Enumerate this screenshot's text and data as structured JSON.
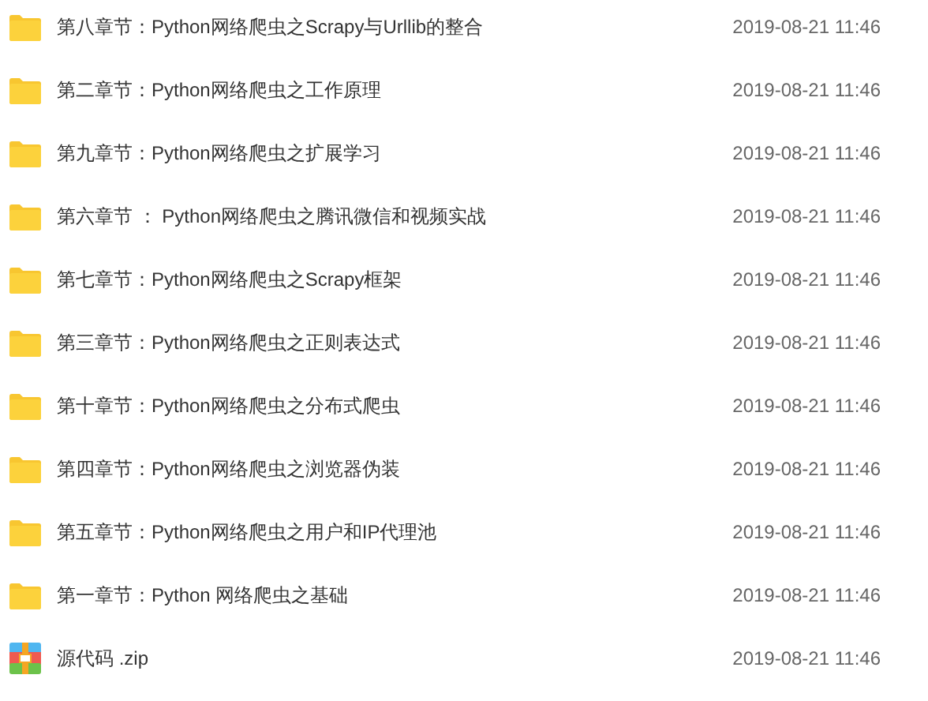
{
  "files": [
    {
      "kind": "folder",
      "name": "第八章节：Python网络爬虫之Scrapy与Urllib的整合",
      "modified": "2019-08-21 11:46"
    },
    {
      "kind": "folder",
      "name": "第二章节：Python网络爬虫之工作原理",
      "modified": "2019-08-21 11:46"
    },
    {
      "kind": "folder",
      "name": "第九章节：Python网络爬虫之扩展学习",
      "modified": "2019-08-21 11:46"
    },
    {
      "kind": "folder",
      "name": "第六章节 ： Python网络爬虫之腾讯微信和视频实战",
      "modified": "2019-08-21 11:46"
    },
    {
      "kind": "folder",
      "name": "第七章节：Python网络爬虫之Scrapy框架",
      "modified": "2019-08-21 11:46"
    },
    {
      "kind": "folder",
      "name": "第三章节：Python网络爬虫之正则表达式",
      "modified": "2019-08-21 11:46"
    },
    {
      "kind": "folder",
      "name": "第十章节：Python网络爬虫之分布式爬虫",
      "modified": "2019-08-21 11:46"
    },
    {
      "kind": "folder",
      "name": "第四章节：Python网络爬虫之浏览器伪装",
      "modified": "2019-08-21 11:46"
    },
    {
      "kind": "folder",
      "name": "第五章节：Python网络爬虫之用户和IP代理池",
      "modified": "2019-08-21 11:46"
    },
    {
      "kind": "folder",
      "name": "第一章节：Python 网络爬虫之基础",
      "modified": "2019-08-21 11:46"
    },
    {
      "kind": "zip",
      "name": "源代码 .zip",
      "modified": "2019-08-21 11:46"
    }
  ]
}
